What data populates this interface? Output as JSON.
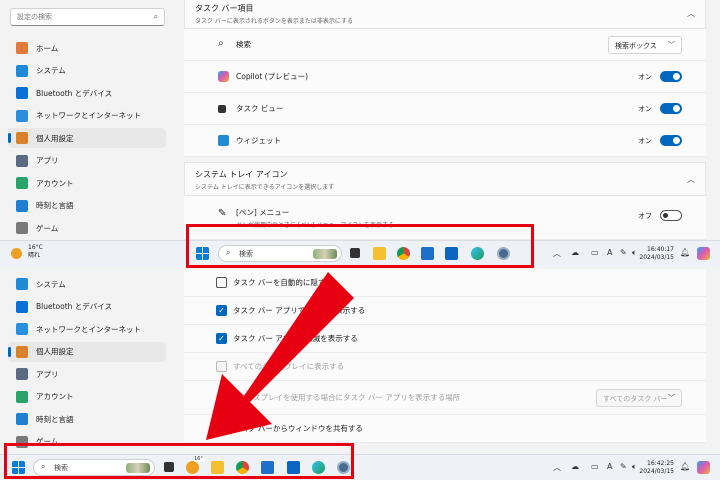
{
  "search": {
    "placeholder": "設定の検索"
  },
  "sidebar_top": [
    {
      "label": "ホーム",
      "icon": "home-icon",
      "color": "#e07a3a",
      "active": false
    },
    {
      "label": "システム",
      "icon": "system-icon",
      "color": "#1f8bd6",
      "active": false
    },
    {
      "label": "Bluetooth とデバイス",
      "icon": "bluetooth-icon",
      "color": "#0a6fd6",
      "active": false
    },
    {
      "label": "ネットワークとインターネット",
      "icon": "wifi-icon",
      "color": "#2b8fe0",
      "active": false
    },
    {
      "label": "個人用設定",
      "icon": "brush-icon",
      "color": "#d9822b",
      "active": true
    },
    {
      "label": "アプリ",
      "icon": "apps-icon",
      "color": "#5a6b82",
      "active": false
    },
    {
      "label": "アカウント",
      "icon": "account-icon",
      "color": "#2aa36b",
      "active": false
    },
    {
      "label": "時刻と言語",
      "icon": "globe-icon",
      "color": "#1f7fd0",
      "active": false
    },
    {
      "label": "ゲーム",
      "icon": "game-icon",
      "color": "#7a7a7a",
      "active": false
    }
  ],
  "sidebar_bottom": [
    {
      "label": "システム",
      "icon": "system-icon",
      "color": "#1f8bd6",
      "active": false
    },
    {
      "label": "Bluetooth とデバイス",
      "icon": "bluetooth-icon",
      "color": "#0a6fd6",
      "active": false
    },
    {
      "label": "ネットワークとインターネット",
      "icon": "wifi-icon",
      "color": "#2b8fe0",
      "active": false
    },
    {
      "label": "個人用設定",
      "icon": "brush-icon",
      "color": "#d9822b",
      "active": true
    },
    {
      "label": "アプリ",
      "icon": "apps-icon",
      "color": "#5a6b82",
      "active": false
    },
    {
      "label": "アカウント",
      "icon": "account-icon",
      "color": "#2aa36b",
      "active": false
    },
    {
      "label": "時刻と言語",
      "icon": "globe-icon",
      "color": "#1f7fd0",
      "active": false
    },
    {
      "label": "ゲーム",
      "icon": "game-icon",
      "color": "#7a7a7a",
      "active": false
    }
  ],
  "taskbar_items": {
    "title": "タスク バー項目",
    "subtitle": "タスク バーに表示されるボタンを表示または非表示にする",
    "search_label": "検索",
    "search_option": "検索ボックス",
    "copilot_label": "Copilot (プレビュー)",
    "taskview_label": "タスク ビュー",
    "widget_label": "ウィジェット",
    "on": "オン"
  },
  "tray_icons": {
    "title": "システム トレイ アイコン",
    "subtitle": "システム トレイに表示できるアイコンを選択します",
    "pen_label": "[ペン] メニュー",
    "pen_sub": "ペンが使用中のときに [ペン] メニューアイコンを表示する",
    "off": "オフ"
  },
  "behaviors": {
    "autohide": "タスク バーを自動的に隠す",
    "badges": "タスク バー アプリでバッジを表示する",
    "flash": "タスク バー アプリで点滅を表示する",
    "multi_display": "すべてのディスプレイに表示する",
    "multi_where": "複数のディスプレイを使用する場合にタスク バー アプリを表示する場所",
    "multi_option": "すべてのタスク バー",
    "share": "タスク バーからウィンドウを共有する"
  },
  "taskbar_top": {
    "weather_temp": "16°C",
    "weather_cond": "晴れ",
    "search": "検索",
    "time": "16:40:17",
    "date": "2024/03/15"
  },
  "taskbar_bottom": {
    "search": "検索",
    "badge": "16°",
    "time": "16:42:25",
    "date": "2024/03/15"
  },
  "tray": {
    "ime": "A"
  },
  "colors": {
    "accent": "#0067c0",
    "highlight": "#e60012"
  }
}
